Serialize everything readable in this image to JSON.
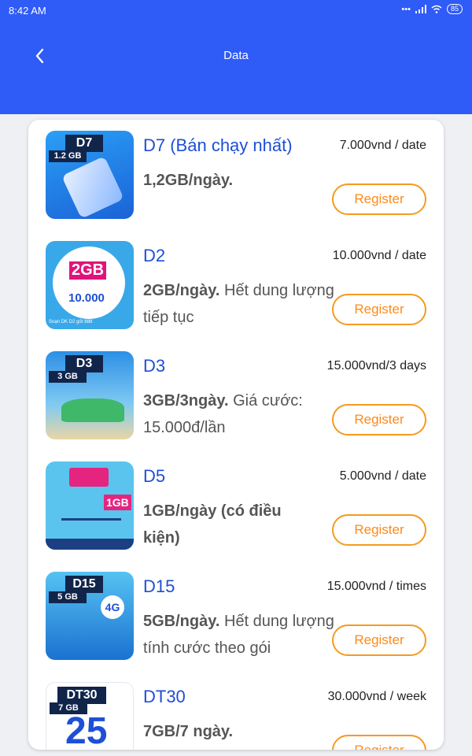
{
  "status_bar": {
    "time": "8:42 AM",
    "battery": "85"
  },
  "header": {
    "title": "Data"
  },
  "packages": [
    {
      "name": "D7 (Bán chạy nhất)",
      "price": "7.000vnd / date",
      "desc_bold": "1,2GB/ngày.",
      "desc_rest": "",
      "badge": "D7",
      "sub_badge": "1.2 GB",
      "register": "Register"
    },
    {
      "name": "D2",
      "price": "10.000vnd / date",
      "desc_bold": "2GB/ngày.",
      "desc_rest": " Hết dung lượng tiếp tục",
      "badge": "",
      "sub_badge": "",
      "banner_big": "2GB",
      "banner_price": "10.000",
      "banner_foot": "Soạn DK D2 gửi 888",
      "register": "Register"
    },
    {
      "name": "D3",
      "price": "15.000vnd/3 days",
      "desc_bold": "3GB/3ngày.",
      "desc_rest": " Giá cước: 15.000đ/lần",
      "badge": "D3",
      "sub_badge": "3 GB",
      "register": "Register"
    },
    {
      "name": "D5",
      "price": "5.000vnd / date",
      "desc_bold": "1GB/ngày (có điều kiện)",
      "desc_rest": "",
      "badge": "",
      "sub_badge": "",
      "banner_big": "1GB",
      "register": "Register"
    },
    {
      "name": "D15",
      "price": "15.000vnd / times",
      "desc_bold": "5GB/ngày.",
      "desc_rest": " Hết dung lượng tính cước theo gói",
      "badge": "D15",
      "sub_badge": "5 GB",
      "banner_big": "4G",
      "register": "Register"
    },
    {
      "name": "DT30",
      "price": "30.000vnd / week",
      "desc_bold": "7GB/7 ngày.",
      "desc_rest": "",
      "badge": "DT30",
      "sub_badge": "7 GB",
      "banner_big": "25",
      "register": "Register"
    }
  ],
  "colors": {
    "header": "#2f5bf7",
    "name": "#1e4fd6",
    "register": "#f49b1f"
  }
}
